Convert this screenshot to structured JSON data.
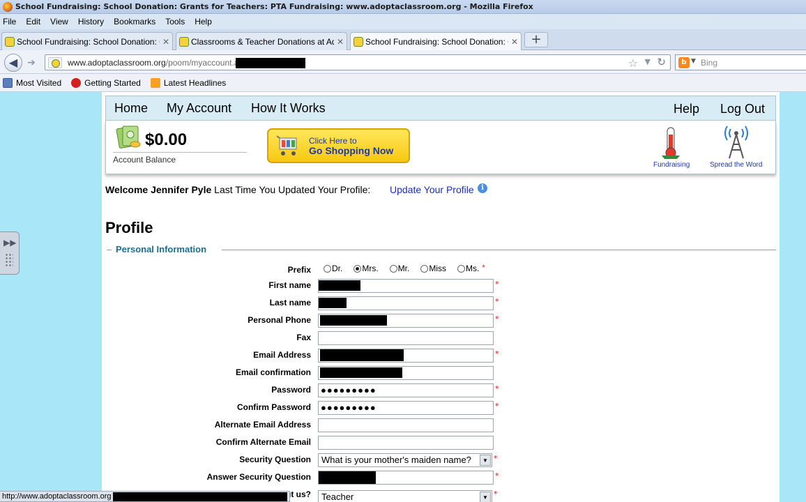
{
  "window": {
    "title": "School Fundraising: School Donation: Grants for Teachers: PTA Fundraising: www.adoptaclassroom.org - Mozilla Firefox"
  },
  "menu": [
    "File",
    "Edit",
    "View",
    "History",
    "Bookmarks",
    "Tools",
    "Help"
  ],
  "tabs": [
    {
      "label": "School Fundraising: School Donation: Gra...",
      "active": false
    },
    {
      "label": "Classrooms & Teacher Donations at Adop...",
      "active": false
    },
    {
      "label": "School Fundraising: School Donation: Gra...",
      "active": true
    }
  ],
  "navbar": {
    "url_domain": "www.adoptaclassroom.org",
    "url_path": "/poom/myaccount.aspx",
    "search_placeholder": "Bing"
  },
  "bookmarks": [
    "Most Visited",
    "Getting Started",
    "Latest Headlines"
  ],
  "site_nav": {
    "home": "Home",
    "my_account": "My Account",
    "how_it_works": "How It Works",
    "help": "Help",
    "log_out": "Log Out"
  },
  "account": {
    "balance": "$0.00",
    "balance_label": "Account Balance",
    "shop_small": "Click Here to",
    "shop_big": "Go Shopping Now",
    "fundraising": "Fundraising",
    "spread_word": "Spread the Word"
  },
  "welcome": {
    "prefix": "Welcome",
    "name": "Jennifer Pyle",
    "last_updated": "Last Time You Updated Your Profile:",
    "update_link": "Update Your Profile"
  },
  "profile": {
    "heading": "Profile",
    "section": "Personal Information",
    "prefix_label": "Prefix",
    "prefix_options": [
      "Dr.",
      "Mrs.",
      "Mr.",
      "Miss",
      "Ms."
    ],
    "prefix_selected": "Mrs.",
    "fields": {
      "first_name": "First name",
      "last_name": "Last name",
      "personal_phone": "Personal Phone",
      "fax": "Fax",
      "email": "Email Address",
      "email_confirm": "Email confirmation",
      "password": "Password",
      "confirm_password": "Confirm Password",
      "alt_email": "Alternate Email Address",
      "confirm_alt_email": "Confirm Alternate Email",
      "security_question": "Security Question",
      "answer_security": "Answer Security Question",
      "how_hear": "ut us?"
    },
    "values": {
      "password": "●●●●●●●●●",
      "confirm_password": "●●●●●●●●●",
      "security_question": "What is your mother's maiden name?",
      "how_hear": "Teacher"
    },
    "required_mark": "*"
  },
  "statusbar": {
    "text": "http://www.adoptaclassroom.org"
  }
}
